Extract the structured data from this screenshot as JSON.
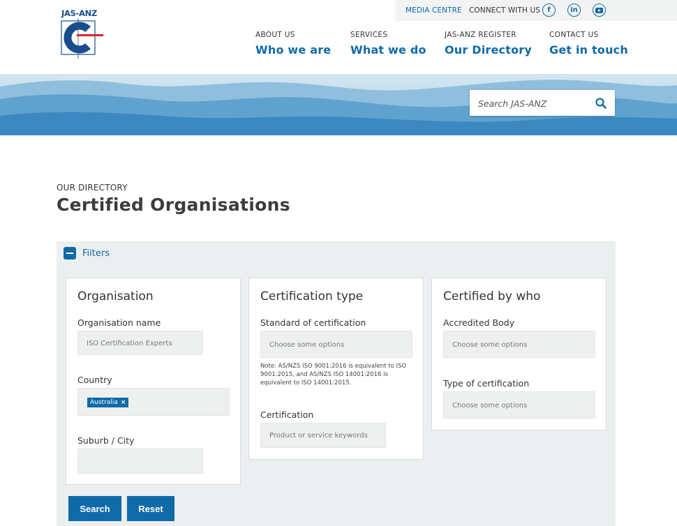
{
  "header": {
    "logo_text": "JAS-ANZ",
    "topbar": {
      "media_centre": "MEDIA CENTRE",
      "connect": "CONNECT WITH US",
      "social": {
        "facebook": "f",
        "linkedin": "in"
      }
    },
    "nav": [
      {
        "small": "ABOUT US",
        "big": "Who we are"
      },
      {
        "small": "SERVICES",
        "big": "What we do"
      },
      {
        "small": "JAS-ANZ REGISTER",
        "big": "Our Directory"
      },
      {
        "small": "CONTACT US",
        "big": "Get in touch"
      }
    ]
  },
  "search": {
    "placeholder": "Search JAS-ANZ"
  },
  "page": {
    "eyebrow": "OUR DIRECTORY",
    "title": "Certified Organisations"
  },
  "filters": {
    "toggle_label": "Filters",
    "organisation": {
      "heading": "Organisation",
      "name_label": "Organisation name",
      "name_placeholder": "ISO Certification Experts",
      "country_label": "Country",
      "country_selected": "Australia",
      "suburb_label": "Suburb / City",
      "suburb_value": ""
    },
    "certification_type": {
      "heading": "Certification type",
      "standard_label": "Standard of certification",
      "standard_placeholder": "Choose some options",
      "note": "Note: AS/NZS ISO 9001:2016 is equivalent to ISO 9001:2015, and AS/NZS ISO 14001:2016 is equivalent to ISO 14001:2015.",
      "certification_label": "Certification",
      "certification_placeholder": "Product or service keywords"
    },
    "certified_by": {
      "heading": "Certified by who",
      "body_label": "Accredited Body",
      "body_placeholder": "Choose some options",
      "type_label": "Type of certification",
      "type_placeholder": "Choose some options"
    },
    "buttons": {
      "search": "Search",
      "reset": "Reset"
    }
  },
  "colors": {
    "accent": "#0f6aa8",
    "panel": "#ecefef",
    "logo_red": "#d9262c",
    "logo_navy": "#1a4d8c"
  }
}
